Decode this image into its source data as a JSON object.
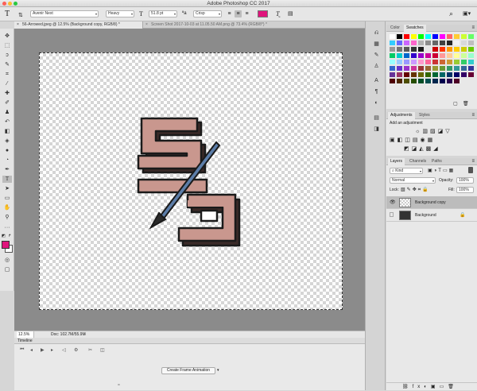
{
  "window": {
    "title": "Adobe Photoshop CC 2017"
  },
  "options_bar": {
    "font_family": "Avenir Next",
    "font_style": "Heavy",
    "font_size": "51.8 pt",
    "aa_mode": "Crisp",
    "text_color": "#e0147c"
  },
  "document_tabs": [
    {
      "label": "56-Arrowed.jpeg @ 12.5% (Background copy, RGB/8) *"
    },
    {
      "label": "Screen Shot 2017-10-03 at 11.05.50 AM.png @ 73.4% (RGB/8*) *"
    }
  ],
  "status": {
    "zoom": "12.5%",
    "doc": "Doc: 102.7M/55.9M"
  },
  "timeline": {
    "title": "Timeline",
    "create_label": "Create Frame Animation"
  },
  "swatches_panel": {
    "tabs": [
      "Color",
      "Swatches"
    ],
    "active": "Swatches"
  },
  "adjustments_panel": {
    "tabs": [
      "Adjustments",
      "Styles"
    ],
    "active": "Adjustments",
    "subtitle": "Add an adjustment"
  },
  "layers_panel": {
    "tabs": [
      "Layers",
      "Channels",
      "Paths"
    ],
    "active": "Layers",
    "filter": "Kind",
    "blend_mode": "Normal",
    "opacity_label": "Opacity:",
    "opacity": "100%",
    "lock_label": "Lock:",
    "fill_label": "Fill:",
    "fill": "100%",
    "layers": [
      {
        "name": "Background copy",
        "selected": true
      },
      {
        "name": "Background",
        "selected": false
      }
    ]
  },
  "colors": {
    "foreground": "#e0147c",
    "background": "#ffffff",
    "artwork_fill": "#c9978e"
  },
  "swatches": [
    "#ffffff",
    "#000000",
    "#ff0000",
    "#ffff00",
    "#00ff00",
    "#00ffff",
    "#0000ff",
    "#ff00ff",
    "#ff6666",
    "#ffcc33",
    "#ccff33",
    "#66ff66",
    "#33ccff",
    "#6666ff",
    "#cc66ff",
    "#ff66cc",
    "#b3b3b3",
    "#8c8c8c",
    "#666666",
    "#404040",
    "#262626",
    "#f2f2f2",
    "#d9d9d9",
    "#bfbfbf",
    "#999999",
    "#737373",
    "#595959",
    "#333333",
    "#1a1a1a",
    "#e6e6e6",
    "#cc0000",
    "#ff3300",
    "#ff9900",
    "#ffcc00",
    "#cccc00",
    "#66cc00",
    "#00cc66",
    "#00cccc",
    "#0066cc",
    "#3300cc",
    "#9900cc",
    "#cc0099",
    "#cc0033",
    "#ff9999",
    "#ffcc99",
    "#ffff99",
    "#ccff99",
    "#99ffcc",
    "#99ffff",
    "#99ccff",
    "#9999ff",
    "#cc99ff",
    "#ff99cc",
    "#ff6699",
    "#cc3333",
    "#cc6633",
    "#cc9933",
    "#99cc33",
    "#33cc66",
    "#33cccc",
    "#3366cc",
    "#6633cc",
    "#9933cc",
    "#cc3399",
    "#993333",
    "#996633",
    "#999933",
    "#669933",
    "#339966",
    "#339999",
    "#336699",
    "#333399",
    "#663399",
    "#993366",
    "#660000",
    "#663300",
    "#666600",
    "#336600",
    "#006633",
    "#006666",
    "#003366",
    "#000066",
    "#330066",
    "#660033",
    "#4d0000",
    "#4d2600",
    "#4d4d00",
    "#264d00",
    "#004d26",
    "#004d4d",
    "#00264d",
    "#00004d",
    "#26004d",
    "#4d0026"
  ]
}
